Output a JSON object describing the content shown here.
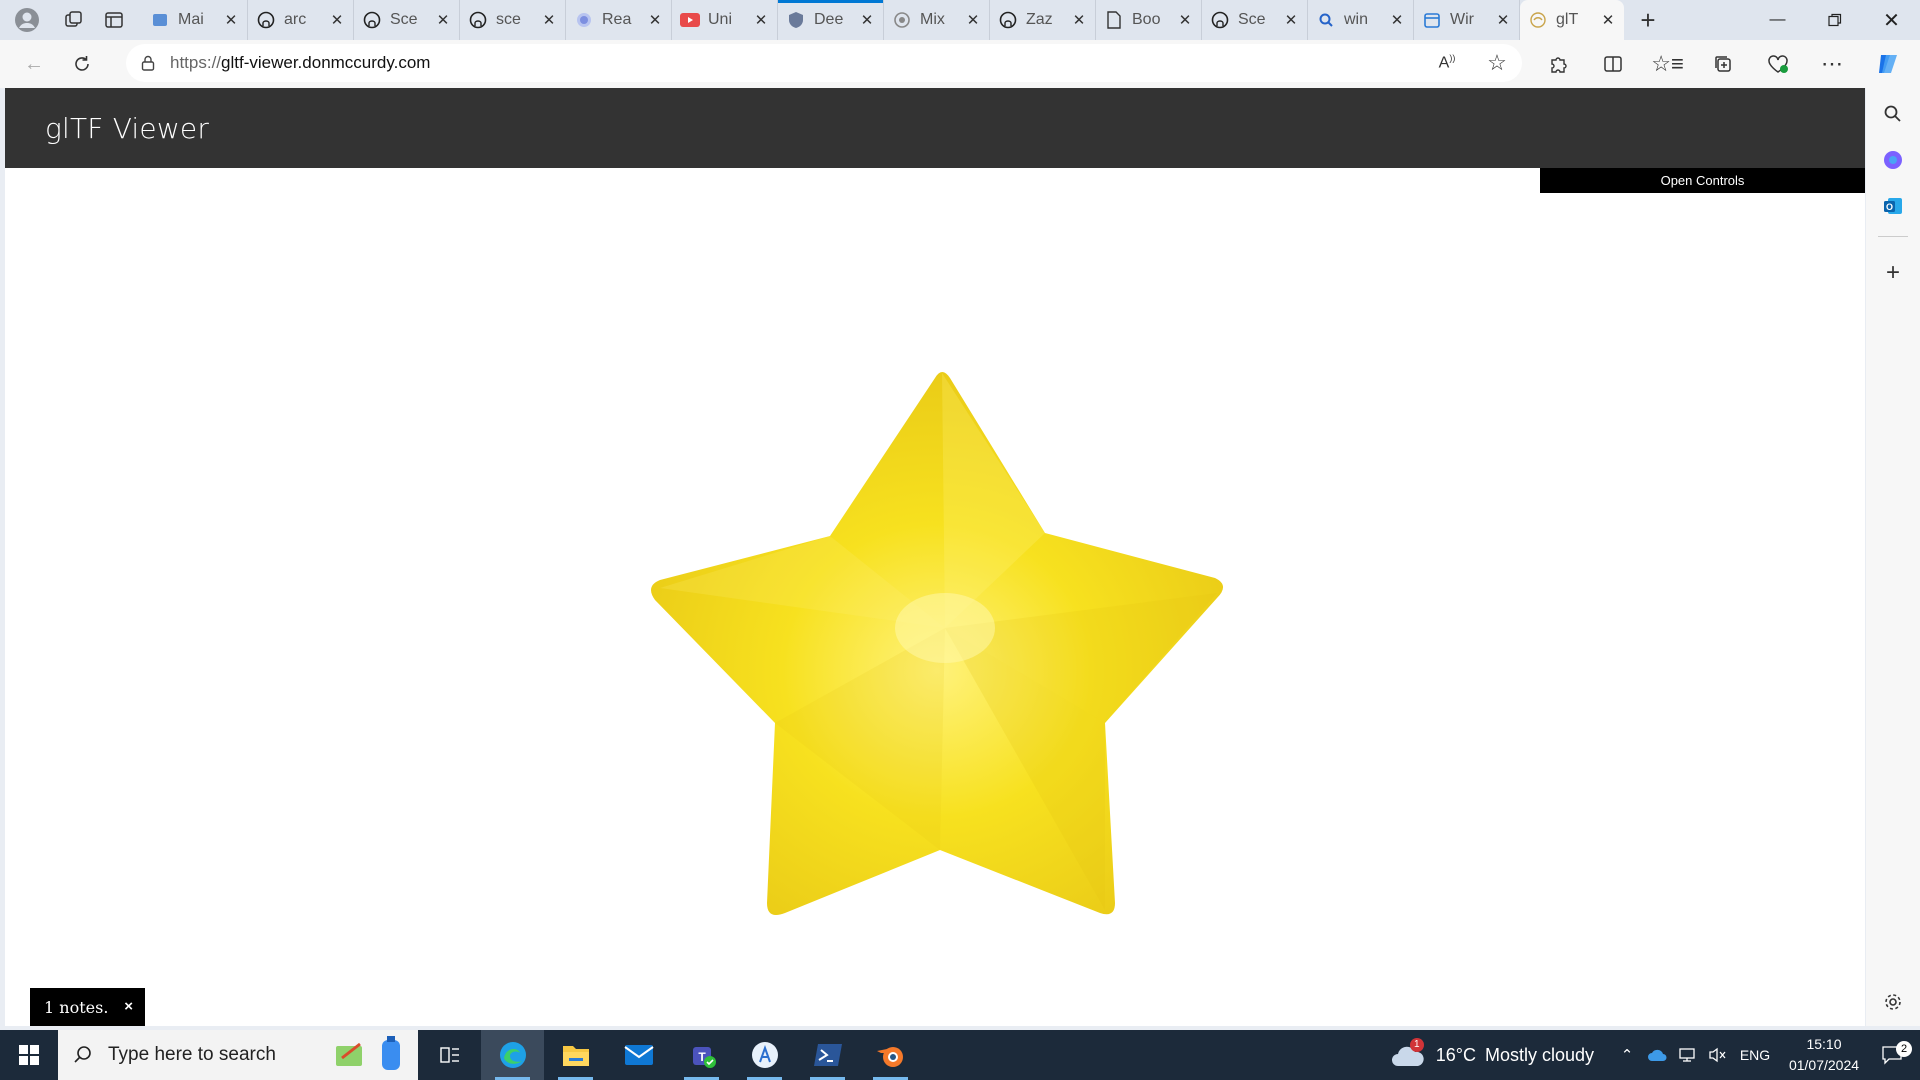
{
  "browser": {
    "tabs": [
      {
        "label": "Mai",
        "icon": "outlook-icon"
      },
      {
        "label": "arc",
        "icon": "github-icon"
      },
      {
        "label": "Sce",
        "icon": "github-icon"
      },
      {
        "label": "sce",
        "icon": "github-icon"
      },
      {
        "label": "Rea",
        "icon": "globe-icon"
      },
      {
        "label": "Uni",
        "icon": "youtube-icon"
      },
      {
        "label": "Dee",
        "icon": "shield-icon"
      },
      {
        "label": "Mix",
        "icon": "ai-icon"
      },
      {
        "label": "Zaz",
        "icon": "github-icon"
      },
      {
        "label": "Boo",
        "icon": "page-icon"
      },
      {
        "label": "Sce",
        "icon": "github-icon"
      },
      {
        "label": "win",
        "icon": "search-icon"
      },
      {
        "label": "Wir",
        "icon": "calendar-icon"
      },
      {
        "label": "glT",
        "icon": "gltf-icon"
      }
    ],
    "url_prefix": "https://",
    "url_host": "gltf-viewer.donmccurdy.com"
  },
  "page": {
    "title": "glTF Viewer",
    "open_controls": "Open Controls",
    "notes": "1 notes.",
    "notes_close": "×",
    "model_colors": {
      "primary": "#f7e11f",
      "light": "#fff27a",
      "shadow": "#e2c412"
    }
  },
  "taskbar": {
    "search_placeholder": "Type here to search",
    "weather_temp": "16°C",
    "weather_desc": "Mostly cloudy",
    "weather_badge": "1",
    "lang": "ENG",
    "time": "15:10",
    "date": "01/07/2024",
    "notifications": "2"
  }
}
